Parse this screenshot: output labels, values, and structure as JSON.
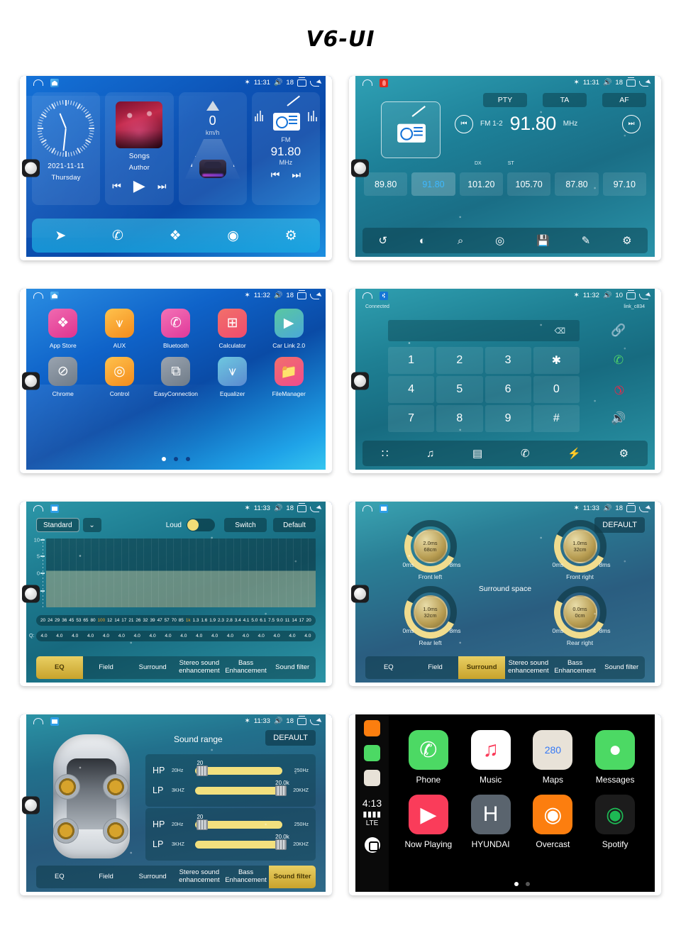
{
  "page": {
    "title": "V6-UI"
  },
  "statusbar": {
    "home_icon": "home-outline-icon",
    "bt_icon": "bluetooth-icon",
    "vol_icon": "volume-icon",
    "recent_icon": "recent-apps-icon",
    "back_icon": "back-icon",
    "p1": {
      "time": "11:31",
      "volume": "18"
    },
    "p2": {
      "time": "11:31",
      "volume": "18"
    },
    "p3": {
      "time": "11:32",
      "volume": "18"
    },
    "p4": {
      "time": "11:32",
      "volume": "10"
    },
    "p5": {
      "time": "11:33",
      "volume": "18"
    },
    "p6": {
      "time": "11:33",
      "volume": "18"
    },
    "p7": {
      "time": "11:33",
      "volume": "18"
    }
  },
  "home": {
    "clock": {
      "date": "2021-11-11",
      "weekday": "Thursday"
    },
    "music": {
      "title": "Songs",
      "artist": "Author",
      "prev": "⏮",
      "play": "▶",
      "next": "⏭"
    },
    "speed": {
      "value": "0",
      "unit": "km/h"
    },
    "radio": {
      "band": "FM",
      "freq": "91.80",
      "unit": "MHz",
      "prev": "⏮",
      "next": "⏭"
    },
    "dock": [
      {
        "name": "navigation-icon",
        "glyph": "➤"
      },
      {
        "name": "phone-icon",
        "glyph": "✆"
      },
      {
        "name": "apps-icon",
        "glyph": "❖"
      },
      {
        "name": "carplay-icon",
        "glyph": "◉"
      },
      {
        "name": "settings-icon",
        "glyph": "⚙"
      }
    ]
  },
  "radio": {
    "rds": [
      "PTY",
      "TA",
      "AF"
    ],
    "band": "FM 1-2",
    "frequency": "91.80",
    "unit": "MHz",
    "prev": "⏮",
    "next": "⏭",
    "dx": "DX",
    "st": "ST",
    "presets": [
      "89.80",
      "91.80",
      "101.20",
      "105.70",
      "87.80",
      "97.10"
    ],
    "active_preset_index": 1,
    "bottom_icons": [
      {
        "name": "band-switch-icon",
        "glyph": "↺"
      },
      {
        "name": "loc-dx-icon",
        "glyph": "◐"
      },
      {
        "name": "search-icon",
        "glyph": "⌕"
      },
      {
        "name": "scan-icon",
        "glyph": "◎"
      },
      {
        "name": "save-icon",
        "glyph": "💾"
      },
      {
        "name": "edit-icon",
        "glyph": "✎"
      },
      {
        "name": "settings-icon",
        "glyph": "⚙"
      }
    ]
  },
  "apps": {
    "items": [
      {
        "label": "App Store",
        "icon": "appstore-icon",
        "color1": "#f06ab0",
        "color2": "#e0338f",
        "glyph": "❖"
      },
      {
        "label": "AUX",
        "icon": "aux-icon",
        "color1": "#ffc24d",
        "color2": "#f38b1c",
        "glyph": "⩛"
      },
      {
        "label": "Bluetooth",
        "icon": "bluetooth-app-icon",
        "color1": "#f472b6",
        "color2": "#e0399a",
        "glyph": "✆"
      },
      {
        "label": "Calculator",
        "icon": "calculator-icon",
        "color1": "#f2706a",
        "color2": "#ef4b6e",
        "glyph": "⊞"
      },
      {
        "label": "Car Link 2.0",
        "icon": "carlink-icon",
        "color1": "#5ac8a0",
        "color2": "#4aa8d8",
        "glyph": "▶"
      },
      {
        "label": "Chrome",
        "icon": "chrome-icon",
        "color1": "#9aa4b0",
        "color2": "#6f7b88",
        "glyph": "⊘"
      },
      {
        "label": "Control",
        "icon": "control-icon",
        "color1": "#ffc24d",
        "color2": "#f38b1c",
        "glyph": "◎"
      },
      {
        "label": "EasyConnection",
        "icon": "easyconnection-icon",
        "color1": "#9aa4b0",
        "color2": "#6f7b88",
        "glyph": "⧉"
      },
      {
        "label": "Equalizer",
        "icon": "equalizer-icon",
        "color1": "#6ec8e0",
        "color2": "#5a8ad0",
        "glyph": "⩛"
      },
      {
        "label": "FileManager",
        "icon": "filemanager-icon",
        "color1": "#f2706a",
        "color2": "#ef4b8e",
        "glyph": "📁"
      }
    ],
    "page_dots": 3,
    "active_page": 0
  },
  "bluetooth": {
    "status": "Connected",
    "device": "link_c834",
    "input_value": "",
    "delete_icon": "backspace-icon",
    "link_icon": "link-icon",
    "keys": [
      "1",
      "2",
      "3",
      "✱",
      "4",
      "5",
      "6",
      "0",
      "7",
      "8",
      "9",
      "#"
    ],
    "side_keys": [
      {
        "name": "call-icon",
        "glyph": "✆",
        "color": "#4fd36a"
      },
      {
        "name": "hangup-icon",
        "glyph": "✆",
        "color": "#e8294a"
      },
      {
        "name": "speaker-icon",
        "glyph": "🔊",
        "color": "#ffffff"
      }
    ],
    "bottom_icons": [
      {
        "name": "dialpad-icon",
        "glyph": "∷"
      },
      {
        "name": "music-icon",
        "glyph": "♫"
      },
      {
        "name": "contacts-icon",
        "glyph": "▤"
      },
      {
        "name": "call-log-icon",
        "glyph": "✆"
      },
      {
        "name": "pair-icon",
        "glyph": "⚡"
      },
      {
        "name": "settings-icon",
        "glyph": "⚙"
      }
    ]
  },
  "equalizer": {
    "preset": "Standard",
    "dropdown_icon": "chevron-down-icon",
    "loud_label": "Loud",
    "loud_on": true,
    "switch_label": "Switch",
    "default_label": "Default",
    "y_axis": [
      "10",
      "5",
      "0",
      "-5"
    ],
    "frequencies": [
      "20",
      "24",
      "29",
      "36",
      "45",
      "53",
      "65",
      "80",
      "100",
      "12",
      "14",
      "17",
      "21",
      "26",
      "32",
      "39",
      "47",
      "57",
      "70",
      "85",
      "1k",
      "1.3",
      "1.6",
      "1.9",
      "2.3",
      "2.8",
      "3.4",
      "4.1",
      "5.0",
      "6.1",
      "7.5",
      "9.0",
      "11",
      "14",
      "17",
      "20"
    ],
    "highlight_frequencies": [
      "100",
      "1k"
    ],
    "q_label": "Q:",
    "q_values": [
      "4.0",
      "4.0",
      "4.0",
      "4.0",
      "4.0",
      "4.0",
      "4.0",
      "4.0",
      "4.0",
      "4.0",
      "4.0",
      "4.0",
      "4.0",
      "4.0",
      "4.0",
      "4.0",
      "4.0",
      "4.0"
    ],
    "tabs": [
      "EQ",
      "Field",
      "Surround",
      "Stereo sound enhancement",
      "Bass Enhancement",
      "Sound filter"
    ],
    "active_tab": "EQ"
  },
  "surround": {
    "default_label": "DEFAULT",
    "title": "Surround space",
    "knobs": [
      {
        "label": "Front left",
        "delay": "2.0ms",
        "distance": "68cm",
        "min": "0ms",
        "max": "8ms"
      },
      {
        "label": "Front right",
        "delay": "1.0ms",
        "distance": "32cm",
        "min": "0ms",
        "max": "8ms"
      },
      {
        "label": "Rear left",
        "delay": "1.0ms",
        "distance": "32cm",
        "min": "0ms",
        "max": "8ms"
      },
      {
        "label": "Rear right",
        "delay": "0.0ms",
        "distance": "0cm",
        "min": "0ms",
        "max": "8ms"
      }
    ],
    "tabs": [
      "EQ",
      "Field",
      "Surround",
      "Stereo sound enhancement",
      "Bass Enhancement",
      "Sound filter"
    ],
    "active_tab": "Surround"
  },
  "sound_filter": {
    "title": "Sound range",
    "default_label": "DEFAULT",
    "groups": [
      {
        "rows": [
          {
            "tag": "HP",
            "min": "20Hz",
            "max": "250Hz",
            "value": "20",
            "thumb_pct": 2
          },
          {
            "tag": "LP",
            "min": "3KHZ",
            "max": "20KHZ",
            "value": "20.0k",
            "thumb_pct": 92
          }
        ]
      },
      {
        "rows": [
          {
            "tag": "HP",
            "min": "20Hz",
            "max": "250Hz",
            "value": "20",
            "thumb_pct": 2
          },
          {
            "tag": "LP",
            "min": "3KHZ",
            "max": "20KHZ",
            "value": "20.0k",
            "thumb_pct": 92
          }
        ]
      }
    ],
    "tabs": [
      "EQ",
      "Field",
      "Surround",
      "Stereo sound enhancement",
      "Bass Enhancement",
      "Sound filter"
    ],
    "active_tab": "Sound filter"
  },
  "carplay": {
    "time": "4:13",
    "signal": "▮▮▮▮",
    "network": "LTE",
    "rail_icons": [
      "overcast-rail-icon",
      "messages-rail-icon",
      "maps-rail-icon"
    ],
    "home_icon": "carplay-home-icon",
    "apps": [
      {
        "label": "Phone",
        "icon": "phone-icon",
        "bg": "#4cd964",
        "fg": "#ffffff",
        "glyph": "✆"
      },
      {
        "label": "Music",
        "icon": "music-icon",
        "bg": "#ffffff",
        "fg": "#fa3c5a",
        "glyph": "♫"
      },
      {
        "label": "Maps",
        "icon": "maps-icon",
        "bg": "#e8e2d8",
        "fg": "#3478f6",
        "glyph": "280"
      },
      {
        "label": "Messages",
        "icon": "messages-icon",
        "bg": "#4cd964",
        "fg": "#ffffff",
        "glyph": "●"
      },
      {
        "label": "Now Playing",
        "icon": "now-playing-icon",
        "bg": "#fa3c5a",
        "fg": "#ffffff",
        "glyph": "▶"
      },
      {
        "label": "HYUNDAI",
        "icon": "hyundai-icon",
        "bg": "#5a646e",
        "fg": "#ffffff",
        "glyph": "H"
      },
      {
        "label": "Overcast",
        "icon": "overcast-icon",
        "bg": "#fc7e0f",
        "fg": "#ffffff",
        "glyph": "◉"
      },
      {
        "label": "Spotify",
        "icon": "spotify-icon",
        "bg": "#1c1c1c",
        "fg": "#1db954",
        "glyph": "◉"
      }
    ],
    "page_dots": 2,
    "active_page": 0
  }
}
